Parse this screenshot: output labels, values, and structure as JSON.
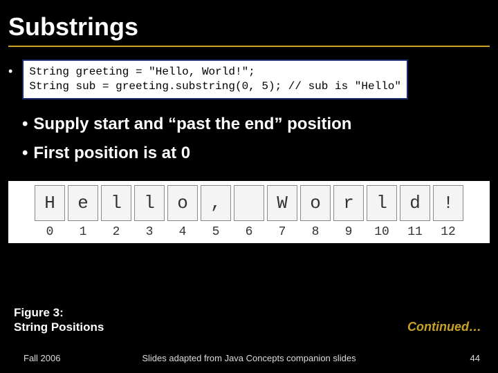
{
  "title": "Substrings",
  "code": {
    "line1": "String greeting = \"Hello, World!\";",
    "line2": "String sub = greeting.substring(0, 5); // sub is \"Hello\""
  },
  "bullets": {
    "b1": "Supply start and “past the end” position",
    "b2": "First position is at 0"
  },
  "diagram": {
    "chars": [
      "H",
      "e",
      "l",
      "l",
      "o",
      ",",
      "",
      "W",
      "o",
      "r",
      "l",
      "d",
      "!"
    ],
    "indices": [
      "0",
      "1",
      "2",
      "3",
      "4",
      "5",
      "6",
      "7",
      "8",
      "9",
      "10",
      "11",
      "12"
    ]
  },
  "caption": {
    "line1": "Figure 3:",
    "line2": "String Positions"
  },
  "continued": "Continued…",
  "footer": {
    "left": "Fall 2006",
    "center": "Slides adapted from Java Concepts companion slides",
    "right": "44"
  }
}
